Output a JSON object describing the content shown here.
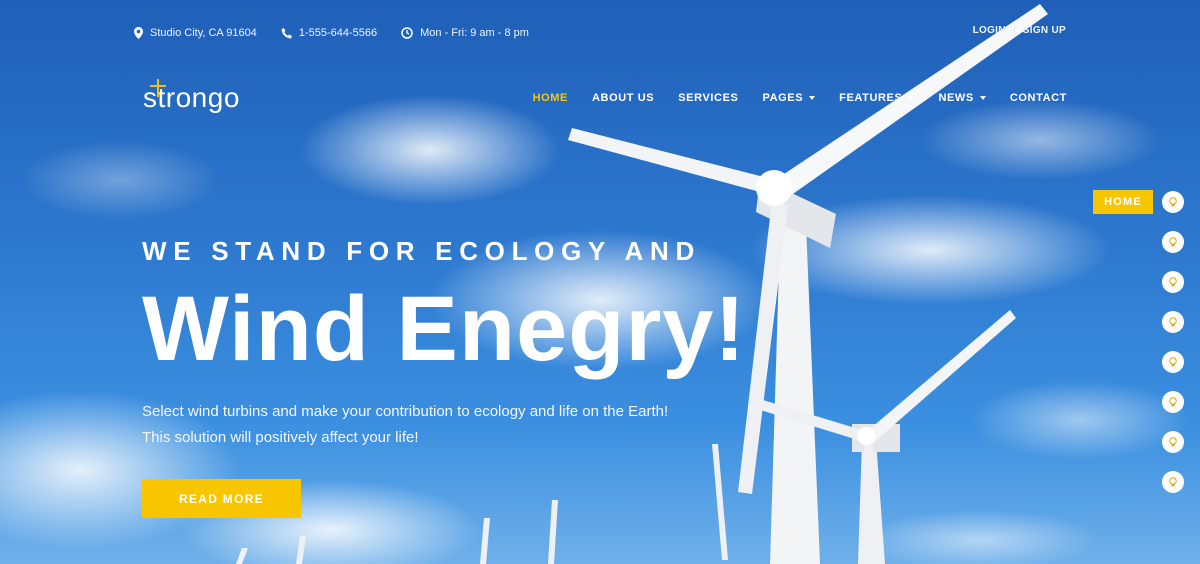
{
  "topbar": {
    "address": "Studio City, CA 91604",
    "phone": "1-555-644-5566",
    "hours": "Mon - Fri: 9 am - 8 pm",
    "login": "LOGIN",
    "signup": "SIGN UP"
  },
  "logo": {
    "text": "strongo"
  },
  "nav": {
    "items": [
      {
        "label": "HOME"
      },
      {
        "label": "ABOUT US"
      },
      {
        "label": "SERVICES"
      },
      {
        "label": "PAGES"
      },
      {
        "label": "FEATURES"
      },
      {
        "label": "NEWS"
      },
      {
        "label": "CONTACT"
      }
    ]
  },
  "hero": {
    "kicker": "WE STAND FOR ECOLOGY AND",
    "headline": "Wind Enegry!",
    "desc_line1": "Select wind turbins and make your contribution to ecology and life on the Earth!",
    "desc_line2": "This solution will positively affect your life!",
    "button": "READ MORE"
  },
  "side_nav": {
    "active_label": "HOME",
    "dot_icon": "lightbulb-icon"
  },
  "colors": {
    "accent": "#f7c600",
    "sky": "#2e7ad0"
  }
}
